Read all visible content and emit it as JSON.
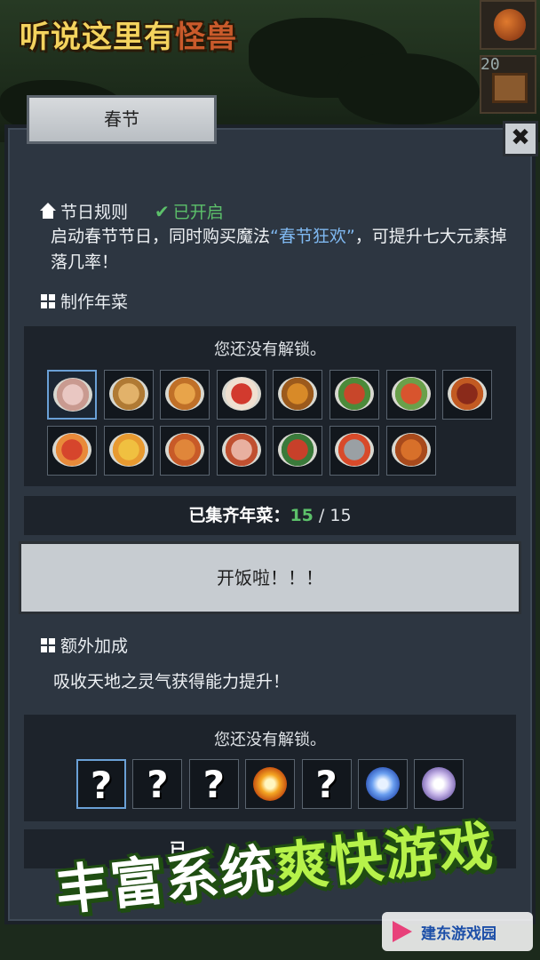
{
  "game": {
    "logo_part1": "听说这里有",
    "logo_part2": "怪兽",
    "chest_count": "20"
  },
  "panel": {
    "tab_title": "春节",
    "close_label": "✖"
  },
  "rules": {
    "heading": "节日规则",
    "status": "已开启",
    "text_before": "启动春节节日，同时购买魔法",
    "magic_name": "“春节狂欢”",
    "text_after": "，可提升七大元素掉落几率！"
  },
  "dishes": {
    "heading": "制作年菜",
    "locked_text": "您还没有解锁。",
    "items": [
      {
        "name": "dish-1",
        "c1": "#e9c7c2",
        "c2": "#c99a90"
      },
      {
        "name": "dish-2",
        "c1": "#e2b26a",
        "c2": "#b07a34"
      },
      {
        "name": "dish-3",
        "c1": "#e8a44a",
        "c2": "#c07028"
      },
      {
        "name": "dish-4",
        "c1": "#d23a2e",
        "c2": "#f0e0d0"
      },
      {
        "name": "dish-5",
        "c1": "#d88a28",
        "c2": "#9c5a1c"
      },
      {
        "name": "dish-6",
        "c1": "#c8462a",
        "c2": "#4c8a3a"
      },
      {
        "name": "dish-7",
        "c1": "#d8542e",
        "c2": "#6aa04a"
      },
      {
        "name": "dish-8",
        "c1": "#8a2a1a",
        "c2": "#c25a22"
      },
      {
        "name": "dish-9",
        "c1": "#d6452c",
        "c2": "#e88a3a"
      },
      {
        "name": "dish-10",
        "c1": "#f0c040",
        "c2": "#e89a30"
      },
      {
        "name": "dish-11",
        "c1": "#e0863a",
        "c2": "#c85a28"
      },
      {
        "name": "dish-12",
        "c1": "#e8b0a0",
        "c2": "#c05030"
      },
      {
        "name": "dish-13",
        "c1": "#c8402a",
        "c2": "#3a7a3a"
      },
      {
        "name": "dish-14",
        "c1": "#9aa0a4",
        "c2": "#d84a2a"
      },
      {
        "name": "dish-15",
        "c1": "#d8702a",
        "c2": "#a84a1c"
      }
    ],
    "collected_label": "已集齐年菜：",
    "collected_count": "15",
    "collected_total": " / 15",
    "feast_button": "开饭啦！！！"
  },
  "bonus": {
    "heading": "额外加成",
    "text": "吸收天地之灵气获得能力提升！",
    "locked_text": "您还没有解锁。",
    "slots": [
      {
        "type": "unknown",
        "label": "?"
      },
      {
        "type": "unknown",
        "label": "?"
      },
      {
        "type": "unknown",
        "label": "?"
      },
      {
        "type": "fire-orb",
        "label": ""
      },
      {
        "type": "unknown",
        "label": "?"
      },
      {
        "type": "water-orb",
        "label": ""
      },
      {
        "type": "spirit-orb",
        "label": ""
      }
    ],
    "bar_label": "已"
  },
  "promo": {
    "part1": "丰富系统",
    "part2": "爽快游戏"
  },
  "watermark": {
    "text": "建东游戏园"
  },
  "colors": {
    "accent_green": "#5cc06a",
    "magic_blue": "#7fb8f0",
    "panel_bg": "#2d3641"
  }
}
